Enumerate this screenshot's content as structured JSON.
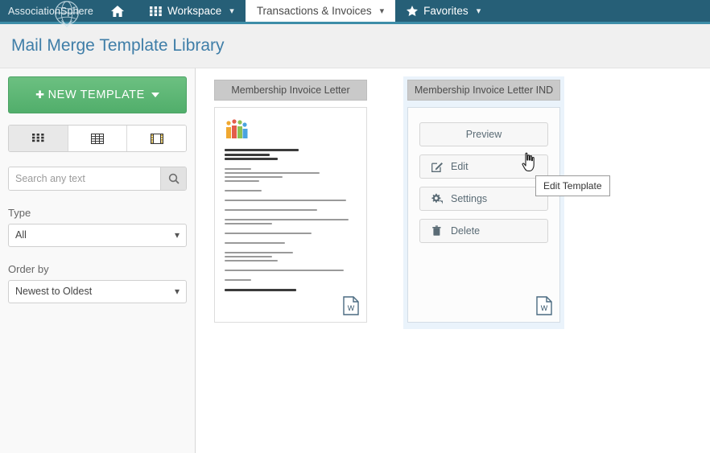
{
  "navbar": {
    "brand": "AssociationSphere",
    "brand_icon": "globe-sphere-icon",
    "items": [
      {
        "label": "",
        "icon": "home-icon",
        "has_caret": false,
        "active": false
      },
      {
        "label": "Workspace",
        "icon": "grid-apps-icon",
        "has_caret": true,
        "active": false
      },
      {
        "label": "Transactions & Invoices",
        "icon": "",
        "has_caret": true,
        "active": true
      },
      {
        "label": "Favorites",
        "icon": "star-icon",
        "has_caret": true,
        "active": false
      }
    ],
    "bg_color": "#265f77",
    "accent_border": "#3d8da8"
  },
  "header": {
    "title": "Mail Merge Template Library",
    "title_color": "#3f7ea8",
    "bg_color": "#f0f0f0"
  },
  "sidebar": {
    "new_template_button": {
      "label": "NEW TEMPLATE",
      "plus_icon": "plus-icon",
      "caret_icon": "triangle-down-icon",
      "color": "#51ae6b"
    },
    "view_modes": [
      {
        "name": "grid-view",
        "icon": "grid-view-icon",
        "active": true
      },
      {
        "name": "table-view",
        "icon": "table-view-icon",
        "active": false
      },
      {
        "name": "filmstrip-view",
        "icon": "filmstrip-view-icon",
        "active": false
      }
    ],
    "search": {
      "placeholder": "Search any text",
      "value": "",
      "button_icon": "search-icon"
    },
    "filters": [
      {
        "label": "Type",
        "value": "All"
      },
      {
        "label": "Order by",
        "value": "Newest to Oldest"
      }
    ]
  },
  "templates": [
    {
      "title": "Membership Invoice Letter",
      "mode": "thumbnail",
      "hovered": false,
      "file_icon": "word-document-icon"
    },
    {
      "title": "Membership Invoice Letter IND",
      "mode": "actions",
      "hovered": true,
      "file_icon": "word-document-icon",
      "actions": [
        {
          "label": "Preview",
          "icon": ""
        },
        {
          "label": "Edit",
          "icon": "pencil-square-icon"
        },
        {
          "label": "Settings",
          "icon": "gears-icon"
        },
        {
          "label": "Delete",
          "icon": "trash-icon"
        }
      ]
    }
  ],
  "tooltip": {
    "text": "Edit Template"
  }
}
